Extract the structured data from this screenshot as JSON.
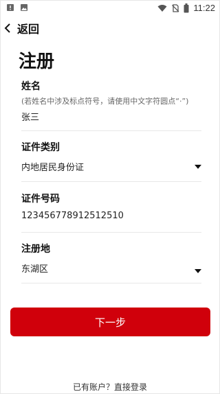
{
  "status_bar": {
    "time": "11:22",
    "left_icons": [
      "alert-icon",
      "image-icon"
    ],
    "right_icons": [
      "wifi-icon",
      "no-sim-icon",
      "battery-icon"
    ]
  },
  "nav": {
    "back_label": "返回"
  },
  "page": {
    "title": "注册"
  },
  "form": {
    "name": {
      "label": "姓名",
      "hint": "(若姓名中涉及标点符号，请使用中文字符圆点“·”)",
      "value": "张三"
    },
    "id_type": {
      "label": "证件类别",
      "value": "内地居民身份证"
    },
    "id_number": {
      "label": "证件号码",
      "value": "123456778912512510"
    },
    "region": {
      "label": "注册地",
      "value": "东湖区"
    }
  },
  "actions": {
    "next_label": "下一步",
    "login_text": "已有账户？直接登录"
  },
  "colors": {
    "accent": "#d0000b"
  }
}
